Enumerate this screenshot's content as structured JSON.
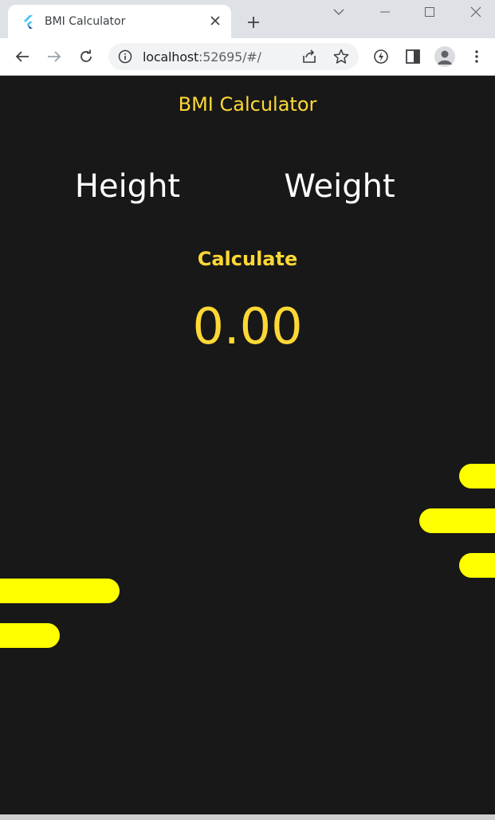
{
  "browser": {
    "tab_title": "BMI Calculator",
    "url_host": "localhost",
    "url_rest": ":52695/#/"
  },
  "icons": {
    "favicon": "flutter-logo-icon",
    "tab_close": "close-icon",
    "new_tab": "plus-icon",
    "minimize": "minimize-icon",
    "maximize": "maximize-icon",
    "close_window": "close-window-icon",
    "tab_search": "chevron-down-icon",
    "back": "arrow-left-icon",
    "forward": "arrow-right-icon",
    "reload": "reload-icon",
    "site_info": "info-icon",
    "share": "share-icon",
    "bookmark": "star-icon",
    "extensions": "performance-icon",
    "side_panel": "side-panel-icon",
    "profile": "avatar-icon",
    "menu": "kebab-menu-icon"
  },
  "colors": {
    "app_background": "#181818",
    "accent": "#fdd835",
    "bar_yellow": "#ffff00",
    "label_white": "#ffffff"
  },
  "app": {
    "title": "BMI Calculator",
    "height_placeholder": "Height",
    "weight_placeholder": "Weight",
    "calculate_label": "Calculate",
    "result": "0.00"
  }
}
